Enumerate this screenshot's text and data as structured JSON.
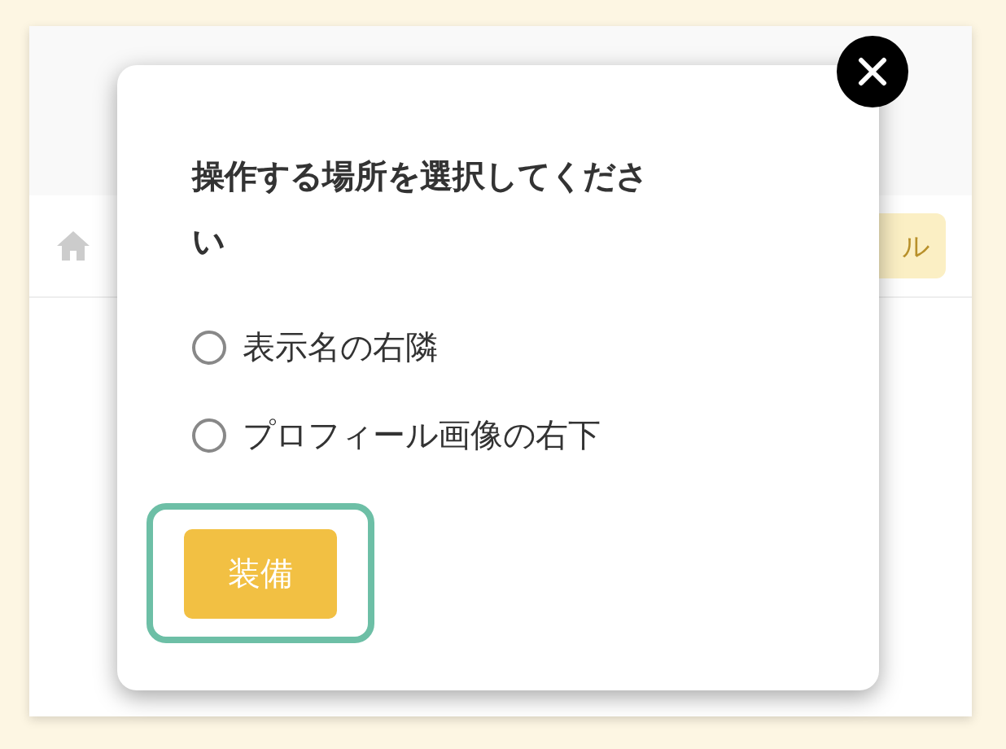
{
  "background": {
    "button_fragment": "ル"
  },
  "dialog": {
    "title": "操作する場所を選択してください",
    "options": [
      {
        "label": "表示名の右隣",
        "selected": false
      },
      {
        "label": "プロフィール画像の右下",
        "selected": false
      }
    ],
    "button": "装備",
    "button_focused": true
  }
}
